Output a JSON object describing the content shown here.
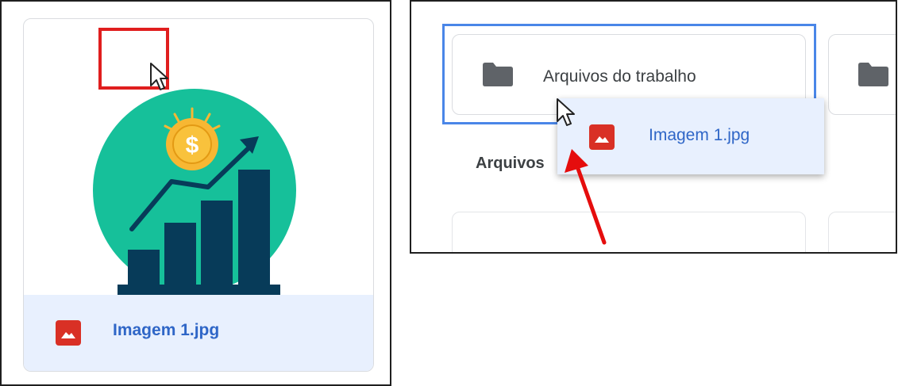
{
  "left_panel": {
    "file_card": {
      "filename": "Imagem 1.jpg",
      "file_icon": "image-file-icon",
      "thumbnail_icon": "growth-chart-dollar-icon"
    },
    "highlight_color": "#e01e1e",
    "cursor_icon": "mouse-pointer-icon"
  },
  "right_panel": {
    "folders": [
      {
        "name": "Arquivos do trabalho",
        "icon": "folder-icon",
        "selected": true
      },
      {
        "name": "",
        "icon": "folder-icon",
        "selected": false
      }
    ],
    "section_label": "Arquivos",
    "drag_chip": {
      "filename": "Imagem 1.jpg",
      "file_icon": "image-file-icon"
    },
    "cursor_icon": "mouse-pointer-icon",
    "arrow_icon": "red-arrow-icon",
    "selection_color": "#4a86e8"
  },
  "colors": {
    "accent_blue": "#2f66c7",
    "chip_background": "#e8f0fe",
    "image_icon_red": "#d93025",
    "folder_gray": "#5f6368"
  }
}
